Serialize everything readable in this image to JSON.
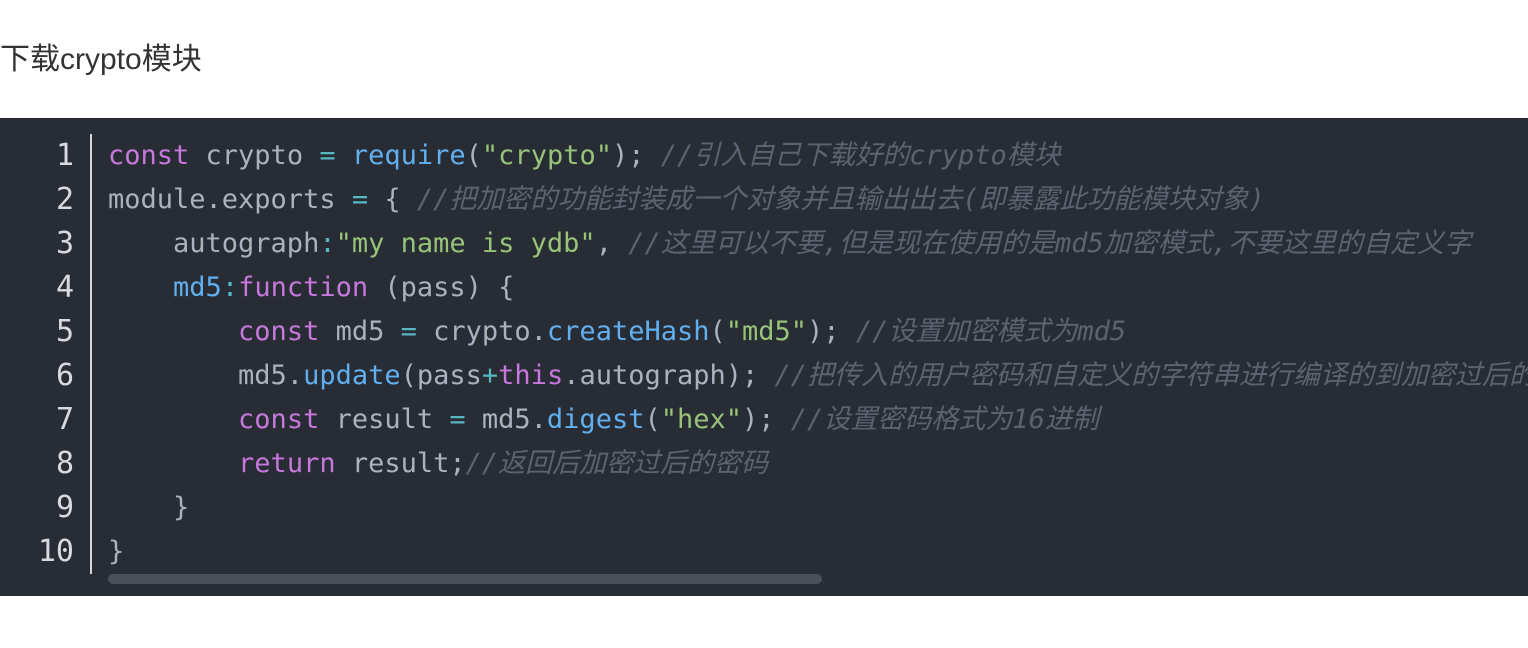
{
  "heading": "下载crypto模块",
  "code": {
    "line_numbers": [
      "1",
      "2",
      "3",
      "4",
      "5",
      "6",
      "7",
      "8",
      "9",
      "10"
    ],
    "lines": [
      [
        {
          "t": "const",
          "c": "kw"
        },
        {
          "t": " crypto ",
          "c": "pl"
        },
        {
          "t": "=",
          "c": "op"
        },
        {
          "t": " ",
          "c": "pl"
        },
        {
          "t": "require",
          "c": "fn"
        },
        {
          "t": "(",
          "c": "pl"
        },
        {
          "t": "\"crypto\"",
          "c": "str"
        },
        {
          "t": "); ",
          "c": "pl"
        },
        {
          "t": "//引入自己下载好的crypto模块",
          "c": "cm"
        }
      ],
      [
        {
          "t": "module.exports ",
          "c": "pl"
        },
        {
          "t": "=",
          "c": "op"
        },
        {
          "t": " { ",
          "c": "pl"
        },
        {
          "t": "//把加密的功能封装成一个对象并且输出出去(即暴露此功能模块对象)",
          "c": "cm"
        }
      ],
      [
        {
          "t": "    autograph",
          "c": "pl"
        },
        {
          "t": ":",
          "c": "op"
        },
        {
          "t": "\"my name is ydb\"",
          "c": "str"
        },
        {
          "t": ", ",
          "c": "pl"
        },
        {
          "t": "//这里可以不要,但是现在使用的是md5加密模式,不要这里的自定义字",
          "c": "cm"
        }
      ],
      [
        {
          "t": "    ",
          "c": "pl"
        },
        {
          "t": "md5",
          "c": "fn"
        },
        {
          "t": ":",
          "c": "op"
        },
        {
          "t": "function",
          "c": "kw"
        },
        {
          "t": " (pass) {",
          "c": "pl"
        }
      ],
      [
        {
          "t": "        ",
          "c": "pl"
        },
        {
          "t": "const",
          "c": "kw"
        },
        {
          "t": " md5 ",
          "c": "pl"
        },
        {
          "t": "=",
          "c": "op"
        },
        {
          "t": " crypto.",
          "c": "pl"
        },
        {
          "t": "createHash",
          "c": "fn"
        },
        {
          "t": "(",
          "c": "pl"
        },
        {
          "t": "\"md5\"",
          "c": "str"
        },
        {
          "t": "); ",
          "c": "pl"
        },
        {
          "t": "//设置加密模式为md5",
          "c": "cm"
        }
      ],
      [
        {
          "t": "        md5.",
          "c": "pl"
        },
        {
          "t": "update",
          "c": "fn"
        },
        {
          "t": "(pass",
          "c": "pl"
        },
        {
          "t": "+",
          "c": "op"
        },
        {
          "t": "this",
          "c": "kw"
        },
        {
          "t": ".autograph); ",
          "c": "pl"
        },
        {
          "t": "//把传入的用户密码和自定义的字符串进行编译的到加密过后的",
          "c": "cm"
        }
      ],
      [
        {
          "t": "        ",
          "c": "pl"
        },
        {
          "t": "const",
          "c": "kw"
        },
        {
          "t": " result ",
          "c": "pl"
        },
        {
          "t": "=",
          "c": "op"
        },
        {
          "t": " md5.",
          "c": "pl"
        },
        {
          "t": "digest",
          "c": "fn"
        },
        {
          "t": "(",
          "c": "pl"
        },
        {
          "t": "\"hex\"",
          "c": "str"
        },
        {
          "t": "); ",
          "c": "pl"
        },
        {
          "t": "//设置密码格式为16进制",
          "c": "cm"
        }
      ],
      [
        {
          "t": "        ",
          "c": "pl"
        },
        {
          "t": "return",
          "c": "kw"
        },
        {
          "t": " result;",
          "c": "pl"
        },
        {
          "t": "//返回后加密过后的密码",
          "c": "cm"
        }
      ],
      [
        {
          "t": "    }",
          "c": "pl"
        }
      ],
      [
        {
          "t": "}",
          "c": "pl"
        }
      ]
    ]
  },
  "colors": {
    "background": "#282c34",
    "keyword": "#c678dd",
    "function": "#61afef",
    "string": "#98c379",
    "operator": "#56b6c2",
    "comment": "#5c6370"
  }
}
